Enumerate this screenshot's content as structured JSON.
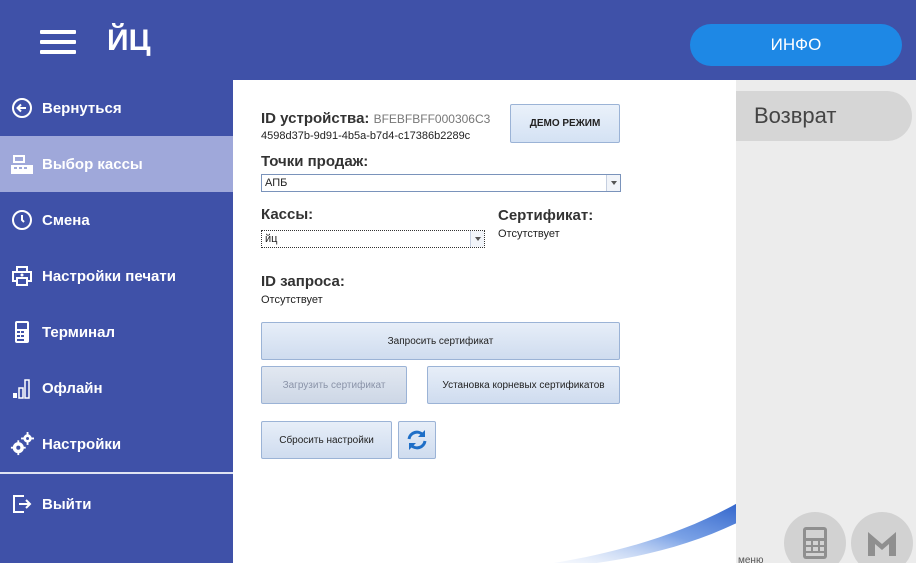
{
  "header": {
    "title": "ЙЦ",
    "info_button": "ИНФО"
  },
  "sidebar": {
    "items": [
      {
        "label": "Вернуться",
        "icon": "back-arrow-icon"
      },
      {
        "label": "Выбор кассы",
        "icon": "cash-register-icon",
        "active": true
      },
      {
        "label": "Смена",
        "icon": "shift-clock-icon"
      },
      {
        "label": "Настройки печати",
        "icon": "printer-icon"
      },
      {
        "label": "Терминал",
        "icon": "terminal-icon"
      },
      {
        "label": "Офлайн",
        "icon": "signal-bars-icon"
      },
      {
        "label": "Настройки",
        "icon": "gears-icon"
      },
      {
        "label": "Выйти",
        "icon": "exit-icon"
      }
    ]
  },
  "main": {
    "device_id_label": "ID устройства:",
    "device_id_value": "BFEBFBFF000306C3",
    "device_guid": "4598d37b-9d91-4b5a-b7d4-c17386b2289c",
    "demo_button": "ДЕМО РЕЖИМ",
    "points_label": "Точки продаж:",
    "points_value": "АПБ",
    "cash_label": "Кассы:",
    "cash_value": "йц",
    "cert_label": "Сертификат:",
    "cert_value": "Отсутствует",
    "request_id_label": "ID запроса:",
    "request_id_value": "Отсутствует",
    "request_cert_button": "Запросить сертификат",
    "upload_cert_button": "Загрузить сертификат",
    "install_root_button": "Установка корневых сертификатов",
    "reset_button": "Сбросить настройки"
  },
  "right": {
    "return_label": "Возврат",
    "menu_text": "меню"
  },
  "colors": {
    "primary": "#3f51a8",
    "active_item": "#9fa8da",
    "info_button": "#1e88e5"
  }
}
